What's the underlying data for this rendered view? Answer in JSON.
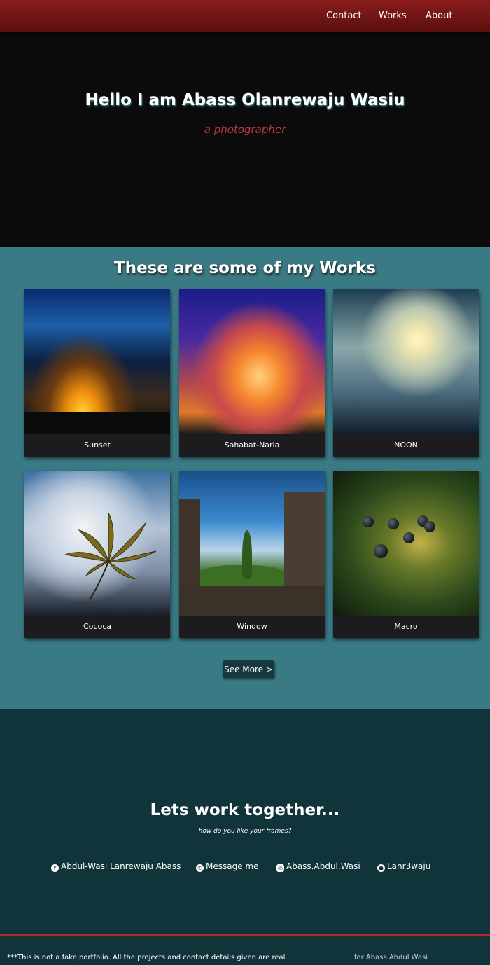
{
  "nav": {
    "items": [
      "Contact",
      "Works",
      "About"
    ]
  },
  "hero": {
    "title": "Hello I am Abass Olanrewaju Wasiu",
    "subtitle": "a photographer"
  },
  "works": {
    "heading": "These are some of my Works",
    "cards": [
      {
        "caption": "Sunset"
      },
      {
        "caption": "Sahabat-Naria"
      },
      {
        "caption": "NOON"
      },
      {
        "caption": "Cococa"
      },
      {
        "caption": "Window"
      },
      {
        "caption": "Macro"
      }
    ],
    "see_more": "See More >"
  },
  "contact": {
    "heading": "Lets work together...",
    "tagline": "how do you like your frames?",
    "links": [
      {
        "icon": "facebook-icon",
        "label": "Abdul-Wasi Lanrewaju Abass"
      },
      {
        "icon": "whatsapp-icon",
        "label": "Message me"
      },
      {
        "icon": "instagram-icon",
        "label": "Abass.Abdul.Wasi"
      },
      {
        "icon": "github-icon",
        "label": "Lanr3waju"
      }
    ]
  },
  "footer": {
    "note": "***This is not a fake portfolio. All the projects and contact details given are real.",
    "credit": "for Abass Abdul Wasi"
  },
  "colors": {
    "nav": "#7a1818",
    "hero": "#0b0b0b",
    "works": "#3a7a85",
    "contact": "#11333a",
    "accent": "#c0393b"
  }
}
